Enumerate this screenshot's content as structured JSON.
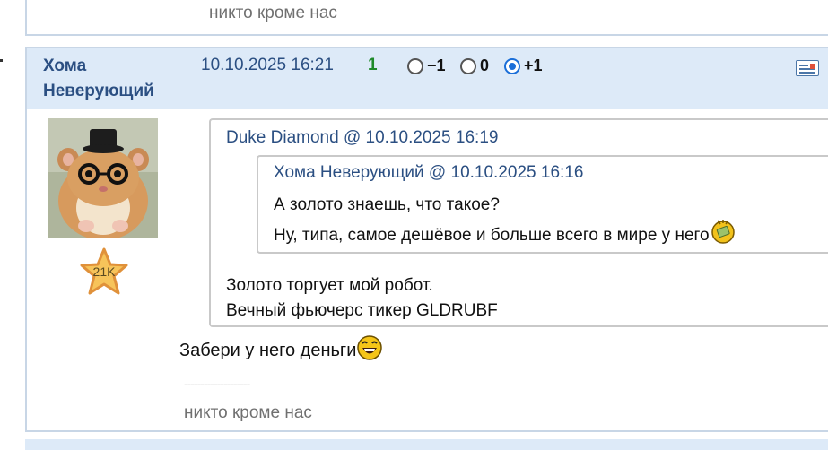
{
  "previous_post": {
    "signature": "никто кроме нас"
  },
  "post": {
    "author_line1": "Хома",
    "author_line2": "Неверующий",
    "datetime": "10.10.2025 16:21",
    "score": "1",
    "vote_options": [
      {
        "label": "−1",
        "selected": false
      },
      {
        "label": "0",
        "selected": false
      },
      {
        "label": "+1",
        "selected": true
      }
    ],
    "author_badge": "21K",
    "quote": {
      "header_author": "Duke Diamond",
      "header_sep": "@",
      "header_datetime": "10.10.2025 16:19",
      "nested_quote": {
        "header_author": "Хома Неверующий",
        "header_sep": "@",
        "header_datetime": "10.10.2025 16:16",
        "lines": [
          "А золото знаешь, что такое?",
          "Ну, типа, самое дешёвое и больше всего в мире у него"
        ]
      },
      "lines": [
        "Золото торгует мой робот.",
        "Вечный фьючерс тикер GLDRUBF"
      ]
    },
    "reply_text": "Забери у него деньги",
    "signature_separator": "--------------------",
    "signature": "никто кроме нас"
  },
  "icons": {
    "report": "report-icon",
    "nested_quote_emoji": "money-emoji-icon",
    "reply_emoji": "laughing-emoji-icon"
  },
  "colors": {
    "header_bg": "#ddeaf8",
    "link": "#2b4f82",
    "score": "#1f8a2a",
    "radio_selected": "#1a6ed8"
  }
}
